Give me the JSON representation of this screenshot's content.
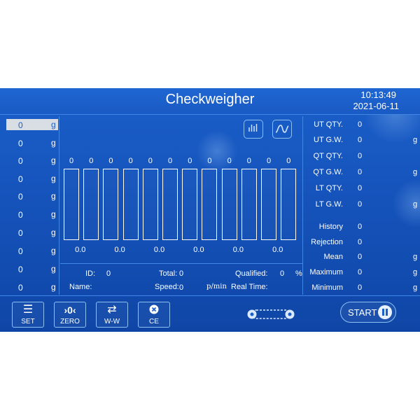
{
  "header": {
    "title": "Checkweigher",
    "time": "10:13:49",
    "date": "2021-06-11"
  },
  "left_list": {
    "items": [
      {
        "value": "0",
        "unit": "g"
      },
      {
        "value": "0",
        "unit": "g"
      },
      {
        "value": "0",
        "unit": "g"
      },
      {
        "value": "0",
        "unit": "g"
      },
      {
        "value": "0",
        "unit": "g"
      },
      {
        "value": "0",
        "unit": "g"
      },
      {
        "value": "0",
        "unit": "g"
      },
      {
        "value": "0",
        "unit": "g"
      },
      {
        "value": "0",
        "unit": "g"
      },
      {
        "value": "0",
        "unit": "g"
      }
    ]
  },
  "chart_icons": [
    "bar-chart-icon",
    "waveform-icon"
  ],
  "bars": {
    "top_values": [
      "0",
      "0",
      "0",
      "0",
      "0",
      "0",
      "0",
      "0",
      "0",
      "0",
      "0",
      "0"
    ],
    "bottom_values": [
      "0.0",
      "0.0",
      "0.0",
      "0.0",
      "0.0",
      "0.0"
    ]
  },
  "info": {
    "id_label": "ID:",
    "id_value": "0",
    "total_label": "Total:",
    "total_value": "0",
    "qualified_label": "Qualified:",
    "qualified_value": "0",
    "qualified_unit": "%",
    "name_label": "Name:",
    "speed_label": "Speed:",
    "speed_value": "0",
    "speed_unit": "p/min",
    "realtime_label": "Real Time:"
  },
  "right_stats": [
    {
      "label": "UT QTY.",
      "value": "0",
      "unit": ""
    },
    {
      "label": "UT G.W.",
      "value": "0",
      "unit": "g"
    },
    {
      "label": "QT QTY.",
      "value": "0",
      "unit": ""
    },
    {
      "label": "QT G.W.",
      "value": "0",
      "unit": "g"
    },
    {
      "label": "LT QTY.",
      "value": "0",
      "unit": ""
    },
    {
      "label": "LT G.W.",
      "value": "0",
      "unit": "g"
    },
    {
      "label": "History",
      "value": "0",
      "unit": ""
    },
    {
      "label": "Rejection",
      "value": "0",
      "unit": ""
    },
    {
      "label": "Mean",
      "value": "0",
      "unit": "g"
    },
    {
      "label": "Maximum",
      "value": "0",
      "unit": "g"
    },
    {
      "label": "Minimum",
      "value": "0",
      "unit": "g"
    }
  ],
  "toolbar": {
    "set_label": "SET",
    "zero_label": "ZERO",
    "ww_label": "W-W",
    "ce_label": "CE",
    "start_label": "START"
  },
  "colors": {
    "background": "#1b5fc9",
    "line": "#3f87e6",
    "button_border": "#8cc0f3"
  }
}
